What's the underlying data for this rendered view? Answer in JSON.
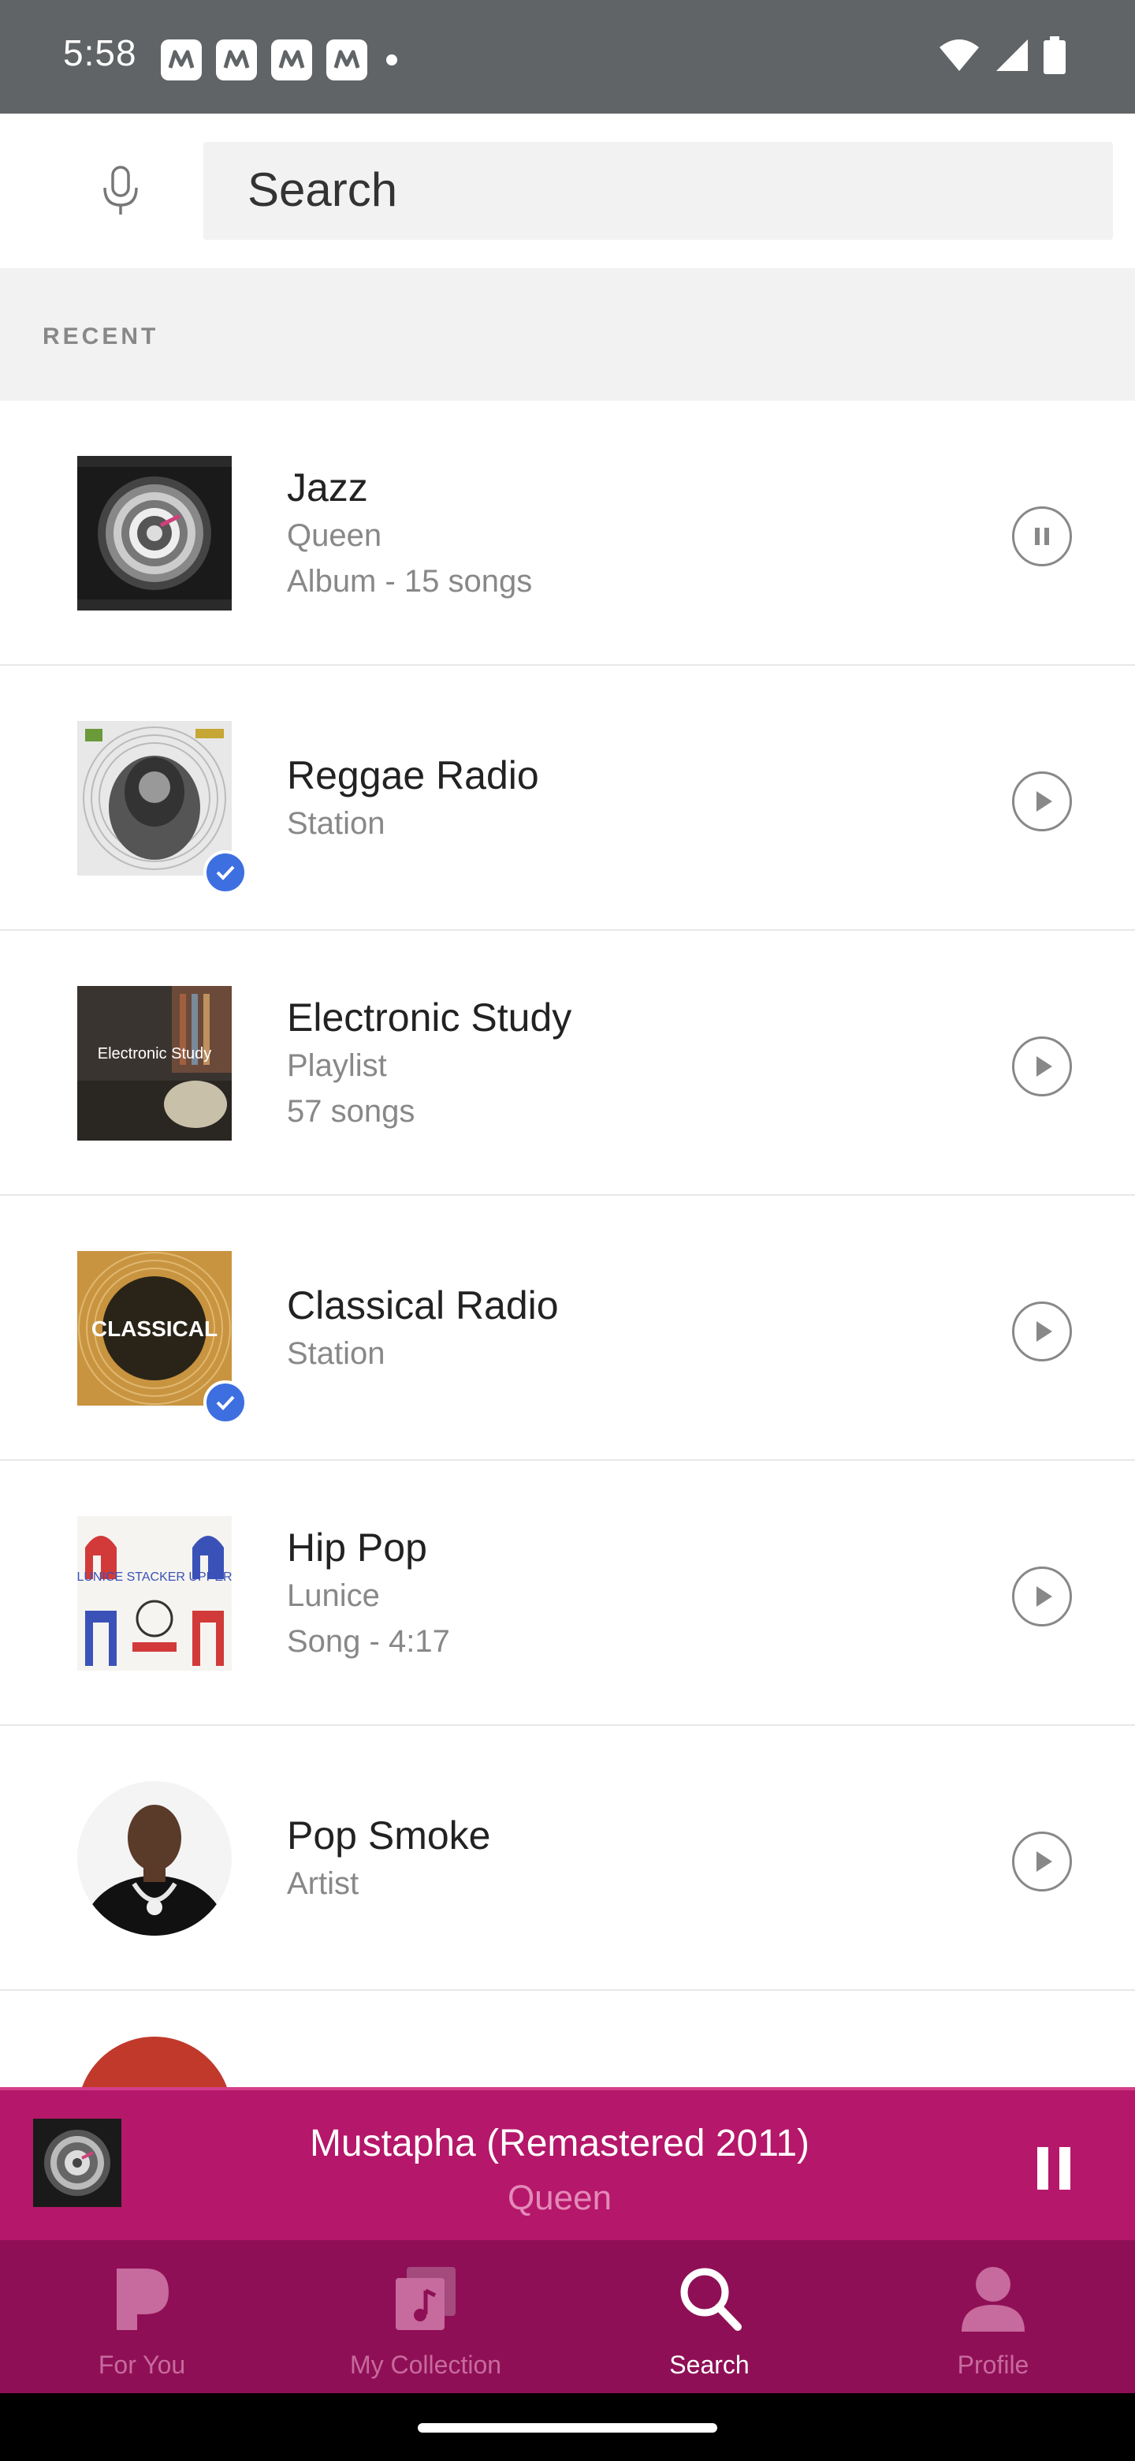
{
  "status_bar": {
    "time": "5:58"
  },
  "search": {
    "placeholder": "Search"
  },
  "section": {
    "recent_label": "RECENT"
  },
  "items": [
    {
      "title": "Jazz",
      "subtitle1": "Queen",
      "subtitle2": "Album - 15 songs",
      "state": "pause"
    },
    {
      "title": "Reggae Radio",
      "subtitle1": "Station",
      "subtitle2": "",
      "state": "play"
    },
    {
      "title": "Electronic Study",
      "subtitle1": "Playlist",
      "subtitle2": "57 songs",
      "state": "play"
    },
    {
      "title": "Classical Radio",
      "subtitle1": "Station",
      "subtitle2": "",
      "state": "play"
    },
    {
      "title": "Hip Pop",
      "subtitle1": "Lunice",
      "subtitle2": "Song - 4:17",
      "state": "play"
    },
    {
      "title": "Pop Smoke",
      "subtitle1": "Artist",
      "subtitle2": "",
      "state": "play"
    }
  ],
  "art_text": {
    "electronic_study": "Electronic Study",
    "classical": "CLASSICAL",
    "hip_pop": "LUNICE STACKER UPPER"
  },
  "mini_player": {
    "title": "Mustapha (Remastered 2011)",
    "artist": "Queen"
  },
  "nav": [
    {
      "label": "For You",
      "icon": "pandora-p-icon"
    },
    {
      "label": "My Collection",
      "icon": "collection-icon"
    },
    {
      "label": "Search",
      "icon": "search-icon"
    },
    {
      "label": "Profile",
      "icon": "profile-icon"
    }
  ],
  "colors": {
    "accent": "#b5176a",
    "nav_bg": "#8f0f56",
    "status_bar": "#616466",
    "check": "#3d6fe0"
  }
}
